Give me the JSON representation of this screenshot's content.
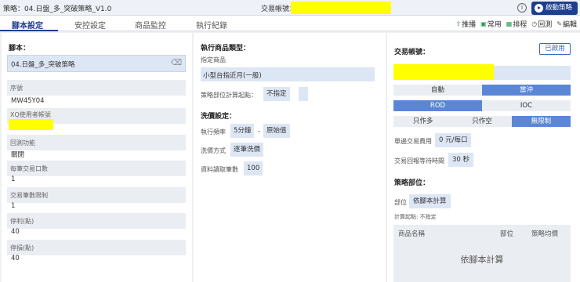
{
  "header": {
    "strategy_label": "策略：",
    "strategy_name": "04.日盤_多_突破策略_V1.0",
    "account_label": "交易帳號：",
    "info_icon": "info-icon",
    "start_label": "啟動策略"
  },
  "tabs": [
    "腳本設定",
    "安控設定",
    "商品監控",
    "執行紀錄"
  ],
  "tools": [
    {
      "icon": "push-icon",
      "label": "推播"
    },
    {
      "icon": "favorite-icon",
      "label": "常用"
    },
    {
      "icon": "schedule-icon",
      "label": "排程"
    },
    {
      "icon": "backtest-icon",
      "label": "回測"
    },
    {
      "icon": "edit-icon",
      "label": "編輯"
    }
  ],
  "script_panel": {
    "title": "腳本：",
    "script_name": "04.日盤_多_突破策略",
    "rows": [
      {
        "label": "序號",
        "value": "MW45Y04"
      },
      {
        "label": "XQ使用者帳號",
        "value": ""
      },
      {
        "label": "回測功能",
        "value": "關閉"
      },
      {
        "label": "每筆交易口數",
        "value": "1"
      },
      {
        "label": "交易筆數限制",
        "value": "1"
      },
      {
        "label": "停利(點)",
        "value": "40"
      },
      {
        "label": "停損(點)",
        "value": "40"
      }
    ]
  },
  "product_panel": {
    "type_title": "執行商品類型：",
    "designated_label": "指定商品",
    "designated_value": "小型台指近月(一般)",
    "position_label": "策略部位計算起點：",
    "position_value": "不指定",
    "wash_title": "洗價設定：",
    "freq_label": "執行頻率",
    "freq_value": "5分鐘",
    "freq_sep": "-",
    "freq_mode": "原始值",
    "wash_label": "洗價方式",
    "wash_value": "逐筆洗價",
    "read_label": "資料讀取筆數",
    "read_value": "100"
  },
  "account_panel": {
    "title": "交易帳號：",
    "used_label": "已啟用",
    "mode_seg": [
      {
        "label": "自動",
        "on": false
      },
      {
        "label": "當沖",
        "on": true
      }
    ],
    "order_seg": [
      {
        "label": "ROD",
        "on": true
      },
      {
        "label": "IOC",
        "on": false
      }
    ],
    "dir_seg": [
      {
        "label": "只作多",
        "on": false
      },
      {
        "label": "只作空",
        "on": false
      },
      {
        "label": "無限制",
        "on": true
      }
    ],
    "fee_label": "單邊交易費用",
    "fee_value": "0 元/每口",
    "wait_label": "交易回報等待時間",
    "wait_value": "30 秒",
    "pos_title": "策略部位：",
    "pos_label": "部位",
    "pos_value": "依腳本計算",
    "calc_note": "計算起點: 不指定",
    "table_headers": [
      "商品名稱",
      "部位",
      "策略均價"
    ],
    "table_empty": "依腳本計算"
  }
}
